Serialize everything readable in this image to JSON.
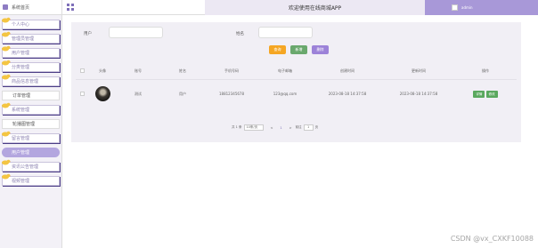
{
  "sidebar": {
    "top_label": "系统首页",
    "items": [
      {
        "label": "个人中心"
      },
      {
        "label": "管理员管理"
      },
      {
        "label": "用户管理"
      },
      {
        "label": "分类管理"
      },
      {
        "label": "商品信息管理"
      },
      {
        "label": "订单管理"
      },
      {
        "label": "系统管理"
      },
      {
        "label": "轮播图管理"
      },
      {
        "label": "留言管理"
      },
      {
        "label": "用户管理"
      },
      {
        "label": "资讯公告管理"
      },
      {
        "label": "视频管理"
      }
    ]
  },
  "header": {
    "title": "欢迎使用在线商城APP",
    "user": "admin"
  },
  "search": {
    "label1": "用户",
    "label2": "姓名",
    "btn_search": "查询",
    "btn_add": "新增",
    "btn_delete": "删除"
  },
  "table": {
    "columns": [
      "",
      "头像",
      "账号",
      "姓名",
      "手机号码",
      "电子邮箱",
      "创建时间",
      "更新时间",
      "操作"
    ],
    "rows": [
      {
        "account": "测试",
        "name": "用户",
        "phone": "18812345678",
        "email": "123@qq.com",
        "created": "2023-08-18 14:37:58",
        "updated": "2023-08-18 14:37:58",
        "op1": "详情",
        "op2": "修改"
      }
    ]
  },
  "pager": {
    "total": "共 1 条",
    "page_size": "10条/页",
    "prev": "<",
    "page": "1",
    "next": ">",
    "goto": "前往",
    "goto_val": "1",
    "unit": "页"
  },
  "watermark": "CSDN @vx_CXKF10088",
  "colors": {
    "accent": "#a898d8",
    "search_btn": "#f5a623",
    "add_btn": "#6aa86d",
    "delete_btn": "#9c82d8"
  }
}
